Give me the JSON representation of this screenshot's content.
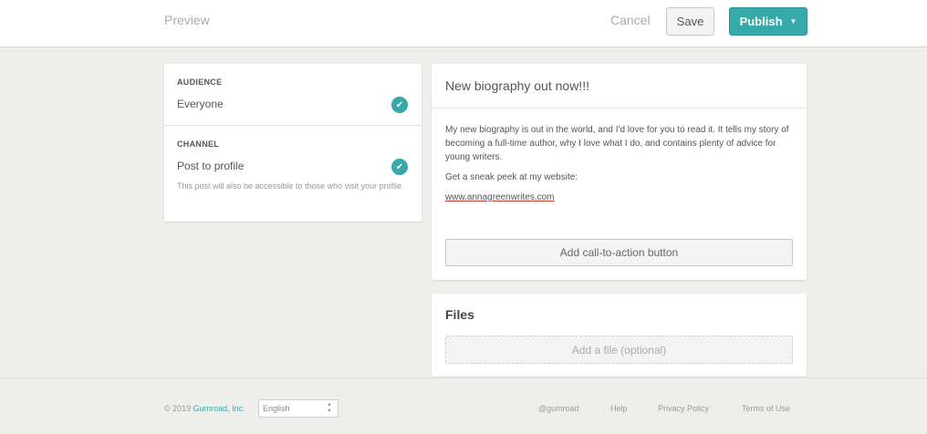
{
  "topbar": {
    "preview_label": "Preview",
    "cancel_label": "Cancel",
    "save_label": "Save",
    "publish_label": "Publish"
  },
  "audience": {
    "audience_heading": "AUDIENCE",
    "audience_value": "Everyone",
    "channel_heading": "CHANNEL",
    "channel_value": "Post to profile",
    "channel_help": "This post will also be accessible to those who visit your profile."
  },
  "post": {
    "title": "New biography out now!!!",
    "paragraph1": "My new biography is out in the world, and I'd love for you to read it. It tells my story of becoming a full-time author, why I love what I do, and contains plenty of advice for young writers.",
    "paragraph2": "Get a sneak peek at my website:",
    "link": "www.annagreenwrites.com",
    "cta_label": "Add call-to-action button"
  },
  "files": {
    "title": "Files",
    "placeholder": "Add a file (optional)"
  },
  "footer": {
    "copyright_prefix": "© 2019 ",
    "brand": "Gumroad, Inc.",
    "language": "English",
    "links": [
      "@gumroad",
      "Help",
      "Privacy Policy",
      "Terms of Use"
    ]
  },
  "colors": {
    "accent": "#36a9aa",
    "background": "#eeeeea"
  }
}
